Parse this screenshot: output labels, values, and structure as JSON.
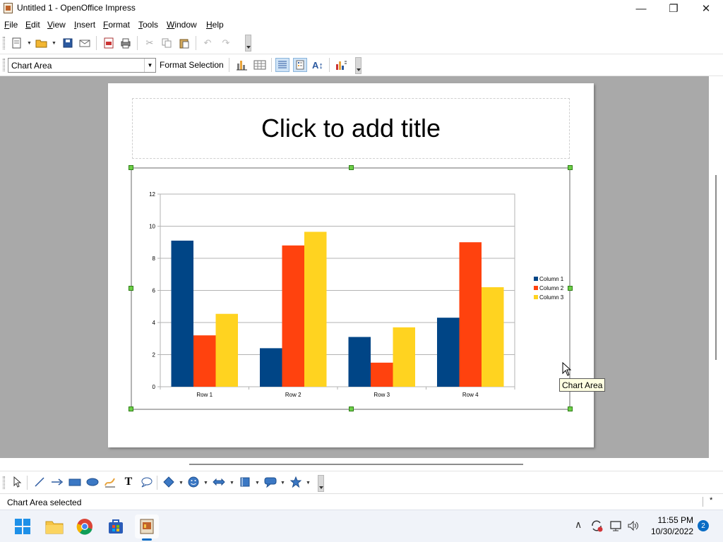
{
  "window": {
    "title": "Untitled 1 - OpenOffice Impress",
    "minimize_glyph": "—",
    "maximize_glyph": "❐",
    "close_glyph": "✕"
  },
  "menu": [
    "File",
    "Edit",
    "View",
    "Insert",
    "Format",
    "Tools",
    "Window",
    "Help"
  ],
  "toolbar2": {
    "element_select_value": "Chart Area",
    "format_selection_label": "Format Selection"
  },
  "slide": {
    "title_placeholder": "Click to add title"
  },
  "chart_data": {
    "type": "bar",
    "title": "",
    "categories": [
      "Row 1",
      "Row 2",
      "Row 3",
      "Row 4"
    ],
    "series": [
      {
        "name": "Column 1",
        "color": "#004586",
        "values": [
          9.1,
          2.4,
          3.1,
          4.3
        ]
      },
      {
        "name": "Column 2",
        "color": "#ff420e",
        "values": [
          3.2,
          8.8,
          1.5,
          9.0
        ]
      },
      {
        "name": "Column 3",
        "color": "#ffd320",
        "values": [
          4.54,
          9.65,
          3.7,
          6.2
        ]
      }
    ],
    "ylim": [
      0,
      12
    ],
    "yticks": [
      0,
      2,
      4,
      6,
      8,
      10,
      12
    ],
    "grid": true,
    "legend_position": "right"
  },
  "tooltip": "Chart Area",
  "status": {
    "text": "Chart Area selected",
    "modified_marker": "*"
  },
  "taskbar": {
    "time": "11:55 PM",
    "date": "10/30/2022",
    "notifications": "2"
  },
  "colors": {
    "accent": "#0a6cc4",
    "handle": "#6ccf47"
  }
}
